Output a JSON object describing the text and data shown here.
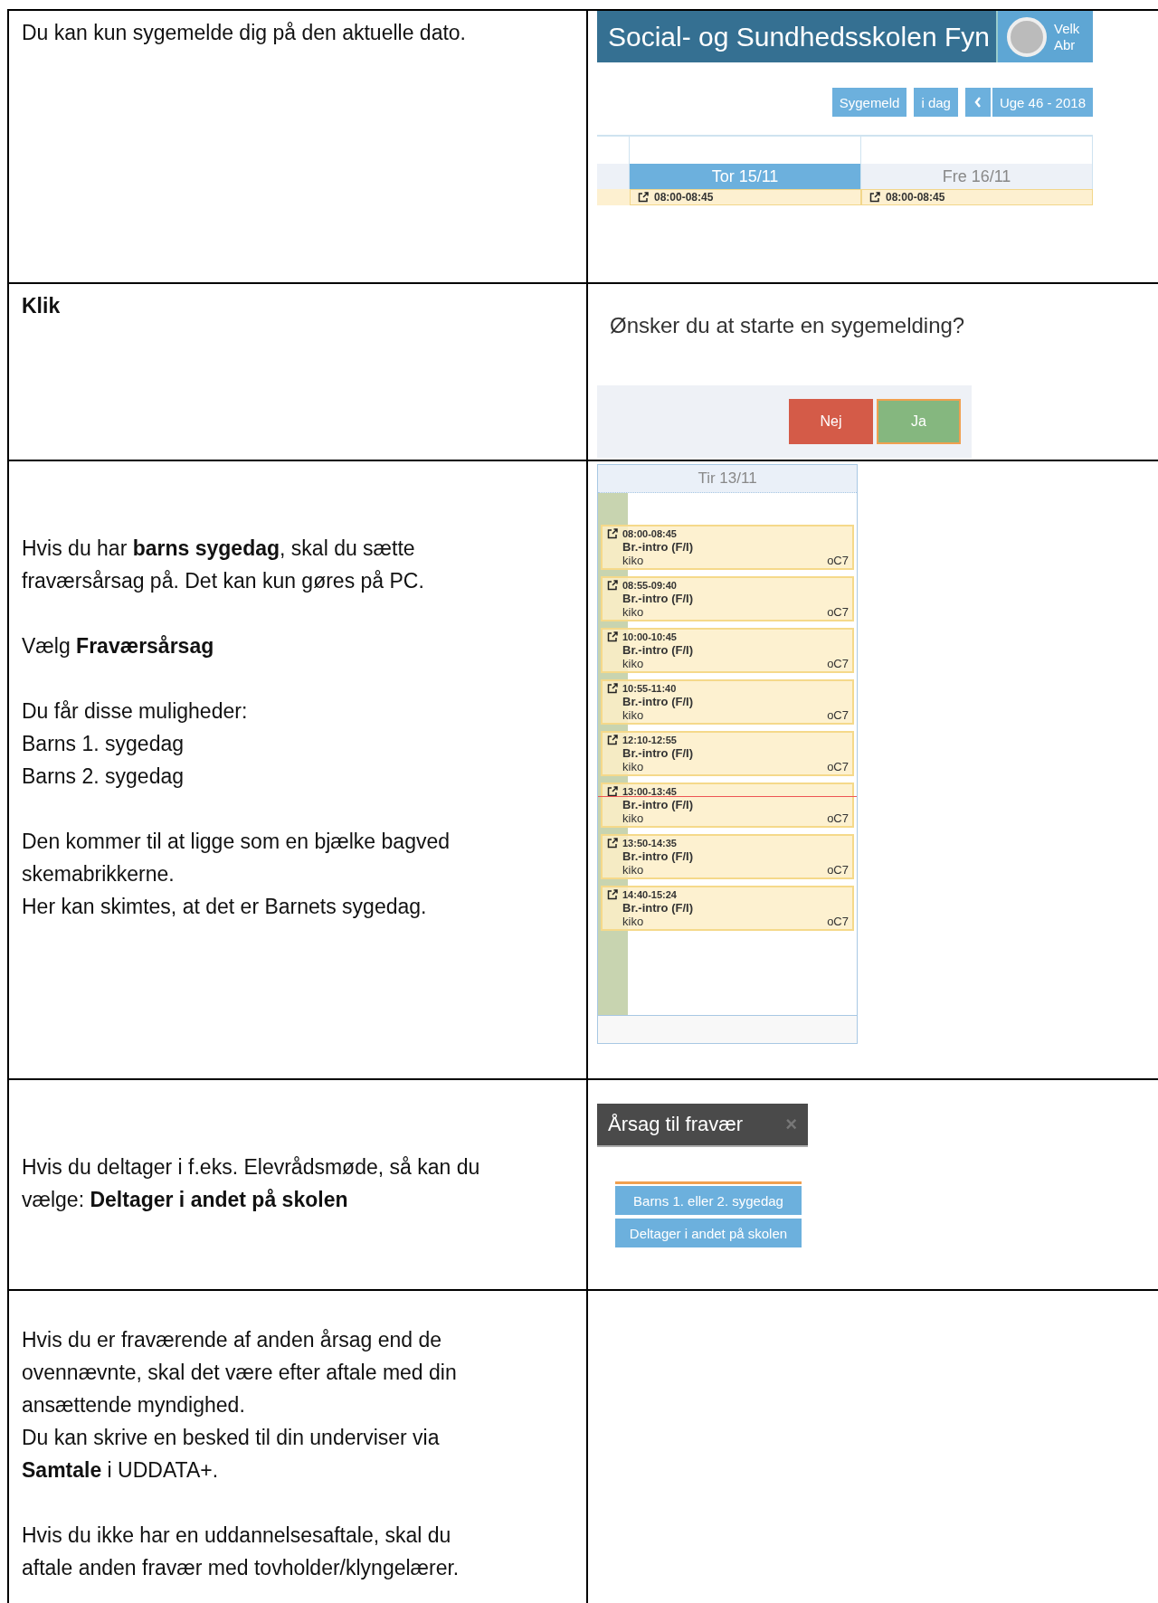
{
  "rows": [
    {
      "text": [
        [
          "Du kan kun sygemelde dig på den aktuelle dato."
        ]
      ],
      "screen": {
        "kind": "week_header",
        "title": "Social- og Sundhedsskolen Fyn",
        "greeting": [
          "Velk",
          "Abr"
        ],
        "buttons": [
          "Sygemeld",
          "i dag"
        ],
        "week": "Uge 46 - 2018",
        "days": [
          {
            "label": "Tor 15/11",
            "selected": true,
            "time": "08:00-08:45"
          },
          {
            "label": "Fre 16/11",
            "selected": false,
            "time": "08:00-08:45"
          }
        ]
      }
    },
    {
      "text": [
        [
          "**Klik**"
        ]
      ],
      "screen": {
        "kind": "confirm",
        "question": "Ønsker du at starte en sygemelding?",
        "buttons": [
          {
            "label": "Nej",
            "kind": "no"
          },
          {
            "label": "Ja",
            "kind": "yes"
          }
        ]
      }
    },
    {
      "text": [
        [
          "Hvis du har **barns sygedag**, skal du sætte",
          "fraværsårsag på.  Det kan kun gøres på PC."
        ],
        [
          "Vælg **Fraværsårsag**"
        ],
        [
          "Du får disse muligheder:",
          "Barns 1. sygedag",
          "Barns 2. sygedag"
        ],
        [
          "Den kommer til at ligge som en bjælke bagved",
          "skemabrikkerne.",
          "Her kan skimtes, at det er Barnets sygedag."
        ]
      ],
      "screen": {
        "kind": "day",
        "day": "Tir 13/11",
        "events": [
          {
            "time": "08:00-08:45",
            "title": "Br.-intro (F/I)",
            "teacher": "kiko",
            "room": "oC7"
          },
          {
            "time": "08:55-09:40",
            "title": "Br.-intro (F/I)",
            "teacher": "kiko",
            "room": "oC7"
          },
          {
            "time": "10:00-10:45",
            "title": "Br.-intro (F/I)",
            "teacher": "kiko",
            "room": "oC7"
          },
          {
            "time": "10:55-11:40",
            "title": "Br.-intro (F/I)",
            "teacher": "kiko",
            "room": "oC7"
          },
          {
            "time": "12:10-12:55",
            "title": "Br.-intro (F/I)",
            "teacher": "kiko",
            "room": "oC7"
          },
          {
            "time": "13:00-13:45",
            "title": "Br.-intro (F/I)",
            "teacher": "kiko",
            "room": "oC7"
          },
          {
            "time": "13:50-14:35",
            "title": "Br.-intro (F/I)",
            "teacher": "kiko",
            "room": "oC7"
          },
          {
            "time": "14:40-15:24",
            "title": "Br.-intro (F/I)",
            "teacher": "kiko",
            "room": "oC7"
          }
        ]
      }
    },
    {
      "text": [
        [
          "Hvis du deltager i f.eks. Elevrådsmøde, så kan du",
          "vælge: **Deltager i andet på skolen**"
        ]
      ],
      "screen": {
        "kind": "reason",
        "title": "Årsag til fravær",
        "close": "×",
        "options": [
          "Barns 1. eller 2. sygedag",
          "Deltager i andet på skolen"
        ]
      }
    },
    {
      "text": [
        [
          "Hvis du er fraværende af anden årsag end de",
          "ovennævnte, skal det være efter aftale med din",
          "ansættende myndighed.",
          "Du kan skrive en besked til din underviser via",
          "**Samtale** i UDDATA+."
        ],
        [
          "Hvis du ikke har en uddannelsesaftale, skal du",
          "aftale anden fravær med tovholder/klyngelærer."
        ]
      ]
    }
  ]
}
